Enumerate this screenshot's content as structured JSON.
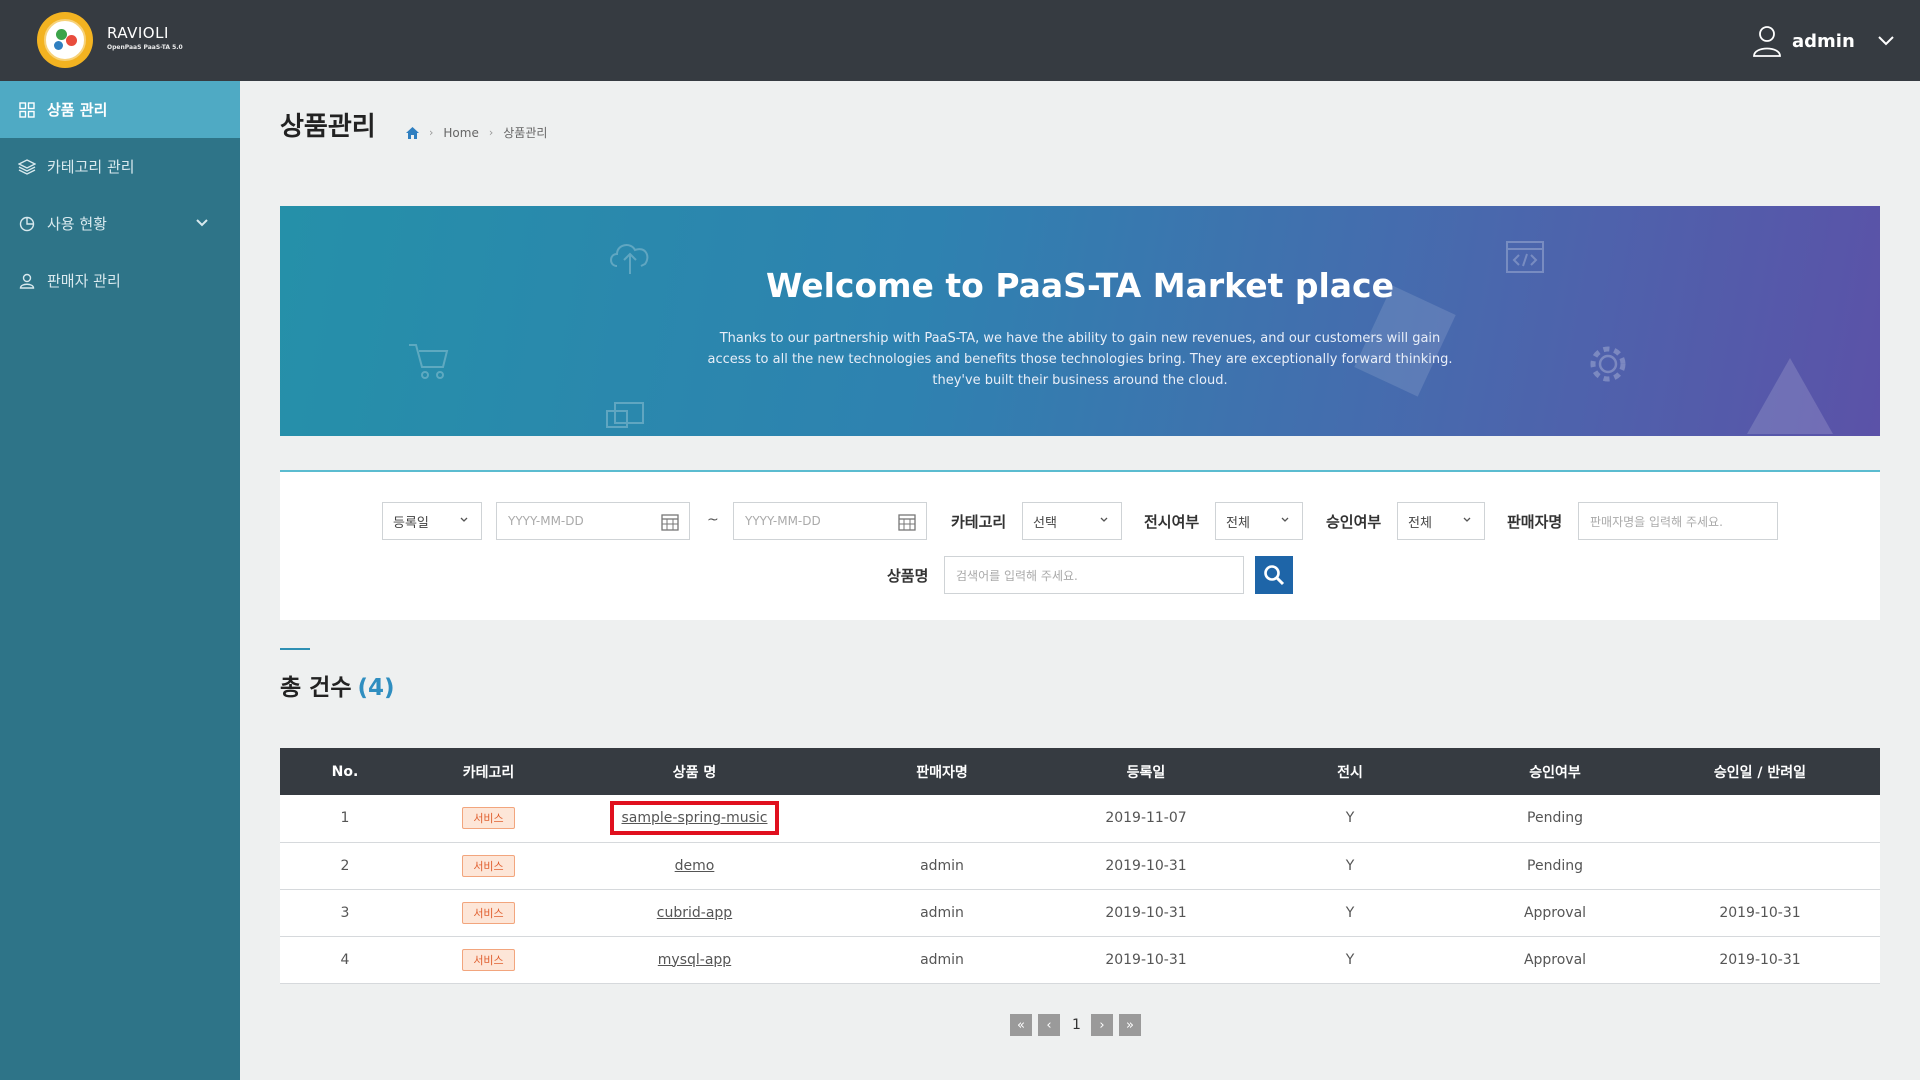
{
  "header": {
    "logo_title": "RAVIOLI",
    "logo_sub": "OpenPaaS PaaS-TA 5.0",
    "username": "admin"
  },
  "sidebar": {
    "items": [
      {
        "label": "상품 관리",
        "icon": "grid-icon",
        "active": true
      },
      {
        "label": "카테고리 관리",
        "icon": "layers-icon",
        "active": false
      },
      {
        "label": "사용 현황",
        "icon": "pie-chart-icon",
        "active": false,
        "expandable": true
      },
      {
        "label": "판매자 관리",
        "icon": "user-icon",
        "active": false
      }
    ]
  },
  "page": {
    "title": "상품관리",
    "breadcrumb": [
      "Home",
      "상품관리"
    ]
  },
  "banner": {
    "title": "Welcome to PaaS-TA Market place",
    "desc_line1": "Thanks to our partnership with PaaS-TA, we have the ability to gain new revenues, and our customers will gain",
    "desc_line2": "access to all the new technologies and benefits those technologies bring. They are exceptionally forward thinking.",
    "desc_line3": "they've built their business around the cloud."
  },
  "filter": {
    "date_type": "등록일",
    "date_from_placeholder": "YYYY-MM-DD",
    "tilde": "~",
    "date_to_placeholder": "YYYY-MM-DD",
    "category_label": "카테고리",
    "category_value": "선택",
    "display_label": "전시여부",
    "display_value": "전체",
    "approval_label": "승인여부",
    "approval_value": "전체",
    "seller_label": "판매자명",
    "seller_placeholder": "판매자명을 입력해 주세요.",
    "product_label": "상품명",
    "product_placeholder": "검색어를 입력해 주세요."
  },
  "total": {
    "label": "총 건수",
    "count": "(4)"
  },
  "table": {
    "headers": [
      "No.",
      "카테고리",
      "상품 명",
      "판매자명",
      "등록일",
      "전시",
      "승인여부",
      "승인일 / 반려일"
    ],
    "rows": [
      {
        "no": "1",
        "category": "서비스",
        "name": "sample-spring-music",
        "seller": "",
        "reg_date": "2019-11-07",
        "display": "Y",
        "approval": "Pending",
        "approval_date": ""
      },
      {
        "no": "2",
        "category": "서비스",
        "name": "demo",
        "seller": "admin",
        "reg_date": "2019-10-31",
        "display": "Y",
        "approval": "Pending",
        "approval_date": ""
      },
      {
        "no": "3",
        "category": "서비스",
        "name": "cubrid-app",
        "seller": "admin",
        "reg_date": "2019-10-31",
        "display": "Y",
        "approval": "Approval",
        "approval_date": "2019-10-31"
      },
      {
        "no": "4",
        "category": "서비스",
        "name": "mysql-app",
        "seller": "admin",
        "reg_date": "2019-10-31",
        "display": "Y",
        "approval": "Approval",
        "approval_date": "2019-10-31"
      }
    ]
  },
  "pagination": {
    "first": "«",
    "prev": "‹",
    "current": "1",
    "next": "›",
    "last": "»"
  },
  "colors": {
    "topbar": "#363b41",
    "sidebar": "#2e7488",
    "sidebar_active": "#4faac4",
    "accent": "#2f8ec0",
    "search_button": "#1e65a8",
    "highlight_box": "#e0101e"
  }
}
